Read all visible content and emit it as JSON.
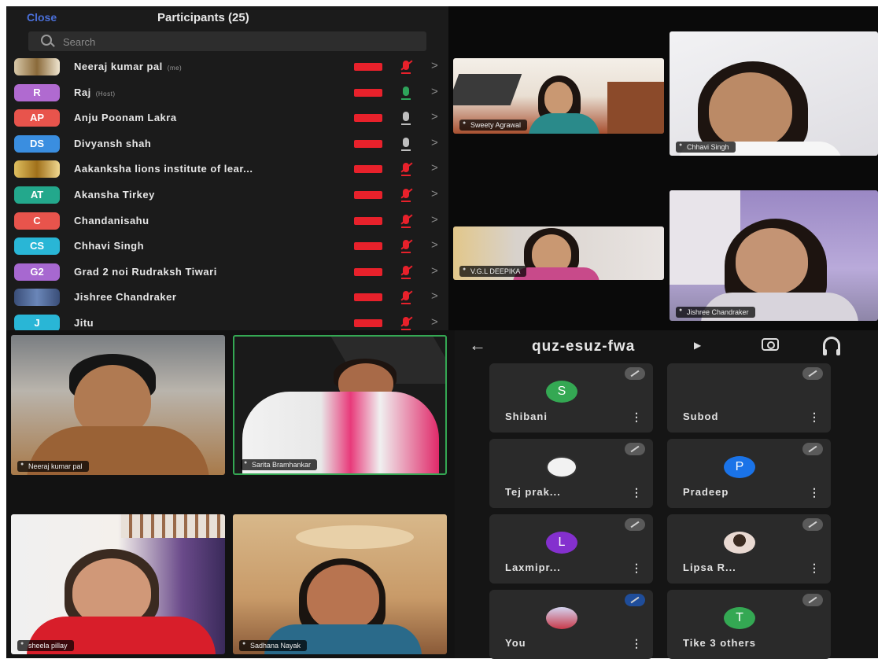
{
  "participants_panel": {
    "close_label": "Close",
    "title": "Participants (25)",
    "search_placeholder": "Search",
    "rows": [
      {
        "initials": "",
        "name": "Neeraj kumar pal",
        "tag": "(me)",
        "avatar_color": "photo",
        "mic": "off"
      },
      {
        "initials": "R",
        "name": "Raj",
        "tag": "(Host)",
        "avatar_color": "#b06ad0",
        "mic": "on"
      },
      {
        "initials": "AP",
        "name": "Anju Poonam Lakra",
        "tag": "",
        "avatar_color": "#e8544c",
        "mic": "on"
      },
      {
        "initials": "DS",
        "name": "Divyansh shah",
        "tag": "",
        "avatar_color": "#3a8ee0",
        "mic": "on"
      },
      {
        "initials": "",
        "name": "Aakanksha lions institute of lear...",
        "tag": "",
        "avatar_color": "photo",
        "mic": "off"
      },
      {
        "initials": "AT",
        "name": "Akansha Tirkey",
        "tag": "",
        "avatar_color": "#23a88c",
        "mic": "off"
      },
      {
        "initials": "C",
        "name": "Chandanisahu",
        "tag": "",
        "avatar_color": "#e8544c",
        "mic": "off"
      },
      {
        "initials": "CS",
        "name": "Chhavi Singh",
        "tag": "",
        "avatar_color": "#29b6d6",
        "mic": "off"
      },
      {
        "initials": "G2",
        "name": "Grad 2 noi Rudraksh Tiwari",
        "tag": "",
        "avatar_color": "#a768d0",
        "mic": "off"
      },
      {
        "initials": "",
        "name": "Jishree Chandraker",
        "tag": "",
        "avatar_color": "#4d6a9a",
        "mic": "off"
      },
      {
        "initials": "J",
        "name": "Jitu",
        "tag": "",
        "avatar_color": "#29b6d6",
        "mic": "off"
      }
    ]
  },
  "video_tiles_top": [
    {
      "name": "Sweety Agrawal"
    },
    {
      "name": "Chhavi Singh"
    },
    {
      "name": "V.G.L DEEPIKA"
    },
    {
      "name": "Jishree Chandraker"
    }
  ],
  "video_tiles_bottom": [
    {
      "name": "Neeraj kumar pal"
    },
    {
      "name": "Sarita Bramhankar"
    },
    {
      "name": "sheela pillay"
    },
    {
      "name": "Sadhana Nayak"
    }
  ],
  "meet": {
    "code": "quz-esuz-fwa",
    "tiles": [
      {
        "label": "Shibani",
        "initial": "S",
        "color": "#34a853"
      },
      {
        "label": "Subod",
        "initial": "",
        "color": ""
      },
      {
        "label": "Tej prak...",
        "initial": "",
        "color": "#f2f2f2"
      },
      {
        "label": "Pradeep",
        "initial": "P",
        "color": "#1a73e8"
      },
      {
        "label": "Laxmipr...",
        "initial": "L",
        "color": "#8430ce"
      },
      {
        "label": "Lipsa R...",
        "initial": "",
        "color": "#e9d9d2"
      },
      {
        "label": "You",
        "initial": "",
        "color": "#d4d4f0"
      },
      {
        "label": "Tike  3 others",
        "initial": "T",
        "color": "#34a853"
      }
    ]
  }
}
